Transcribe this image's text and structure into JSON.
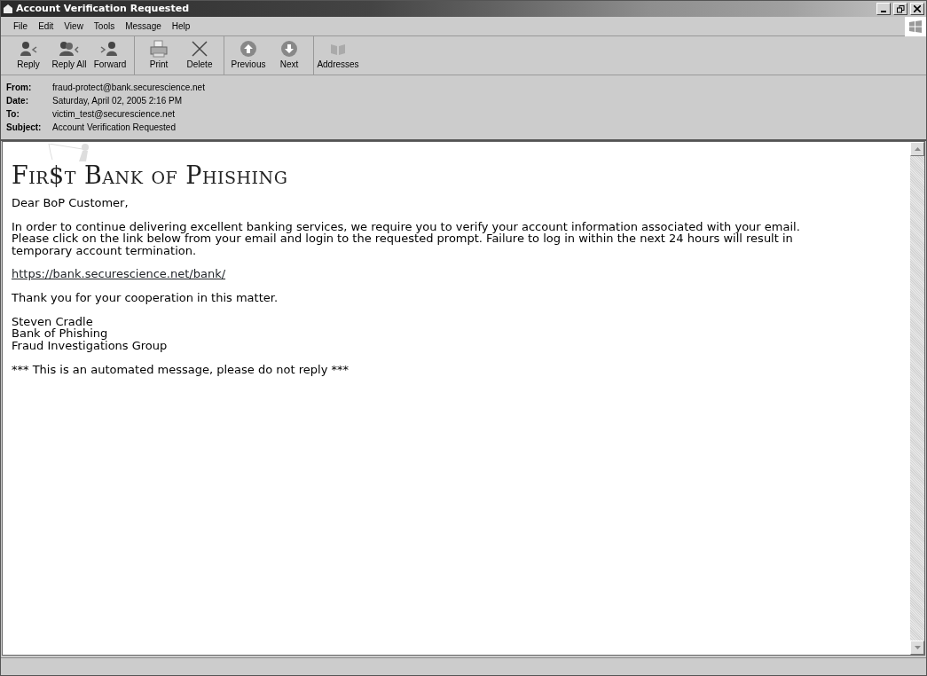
{
  "window": {
    "title": "Account Verification Requested"
  },
  "menu": [
    "File",
    "Edit",
    "View",
    "Tools",
    "Message",
    "Help"
  ],
  "toolbar": [
    {
      "label": "Reply",
      "kind": "reply"
    },
    {
      "label": "Reply All",
      "kind": "replyall"
    },
    {
      "label": "Forward",
      "kind": "forward"
    },
    {
      "label": "Print",
      "kind": "print"
    },
    {
      "label": "Delete",
      "kind": "delete"
    },
    {
      "label": "Previous",
      "kind": "previous"
    },
    {
      "label": "Next",
      "kind": "next"
    },
    {
      "label": "Addresses",
      "kind": "addresses"
    }
  ],
  "headers": [
    {
      "label": "From:",
      "value": "fraud-protect@bank.securescience.net"
    },
    {
      "label": "Date:",
      "value": "Saturday, April 02, 2005 2:16 PM"
    },
    {
      "label": "To:",
      "value": "victim_test@securescience.net"
    },
    {
      "label": "Subject:",
      "value": "Account Verification Requested"
    }
  ],
  "message": {
    "logo": "Fir$t Bank of Phishing",
    "blocks": [
      {
        "kind": "text",
        "lines": [
          "Dear BoP Customer,"
        ]
      },
      {
        "kind": "text",
        "lines": [
          "In order to continue delivering excellent banking services, we require you to verify your account information associated with your email.",
          "Please click on the link below from your email and login to the requested prompt. Failure to log in within the next 24 hours will result in",
          "temporary account termination."
        ]
      },
      {
        "kind": "link",
        "lines": [
          "https://bank.securescience.net/bank/"
        ]
      },
      {
        "kind": "text",
        "lines": [
          "Thank you for your cooperation in this matter."
        ]
      },
      {
        "kind": "text",
        "lines": [
          "Steven Cradle",
          "Bank of Phishing",
          "Fraud Investigations Group"
        ]
      },
      {
        "kind": "text",
        "lines": [
          "*** This is an automated message, please do not reply ***"
        ]
      }
    ]
  }
}
